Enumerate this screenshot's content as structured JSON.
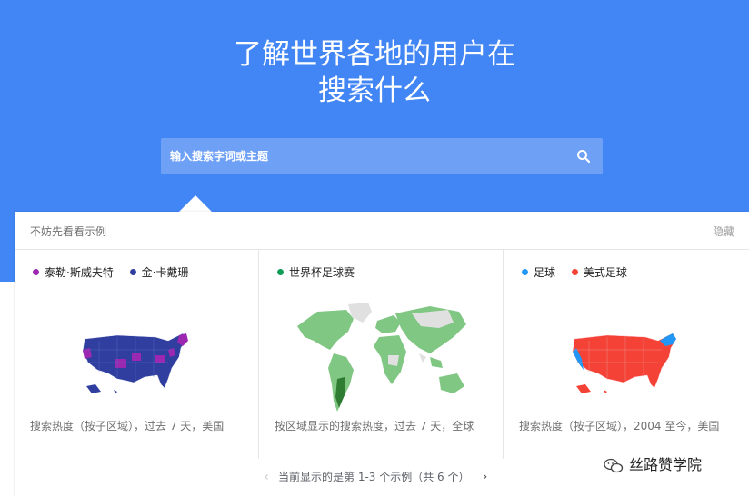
{
  "hero": {
    "title_line1": "了解世界各地的用户在",
    "title_line2": "搜索什么"
  },
  "search": {
    "placeholder": "输入搜索字词或主题",
    "icon": "search-icon"
  },
  "examples": {
    "label": "不妨先看看示例",
    "hide_label": "隐藏"
  },
  "cards": [
    {
      "legend": [
        {
          "label": "泰勒·斯威夫特",
          "color": "#9c27b0"
        },
        {
          "label": "金·卡戴珊",
          "color": "#303f9f"
        }
      ],
      "note": "搜索热度（按子区域），过去 7 天，美国",
      "map": "us-map"
    },
    {
      "legend": [
        {
          "label": "世界杯足球赛",
          "color": "#0f9d58"
        }
      ],
      "note": "按区域显示的搜索热度，过去 7 天，全球",
      "map": "world-map"
    },
    {
      "legend": [
        {
          "label": "足球",
          "color": "#2196f3"
        },
        {
          "label": "美式足球",
          "color": "#f44336"
        }
      ],
      "note": "搜索热度（按子区域），2004 至今，美国",
      "map": "us-map"
    }
  ],
  "pager": {
    "text": "当前显示的是第 1-3 个示例（共 6 个）",
    "prev_icon": "chevron-left-icon",
    "next_icon": "chevron-right-icon"
  },
  "watermark": {
    "text": "丝路赞学院",
    "icon": "wechat-icon"
  },
  "colors": {
    "hero_bg": "#4285f4",
    "us_blue": "#303f9f",
    "us_purple": "#9c27b0",
    "us_red": "#f44336",
    "us_lightblue": "#2196f3",
    "world_green": "#81c784",
    "world_dark": "#2e7d32",
    "world_grey": "#e0e0e0"
  }
}
